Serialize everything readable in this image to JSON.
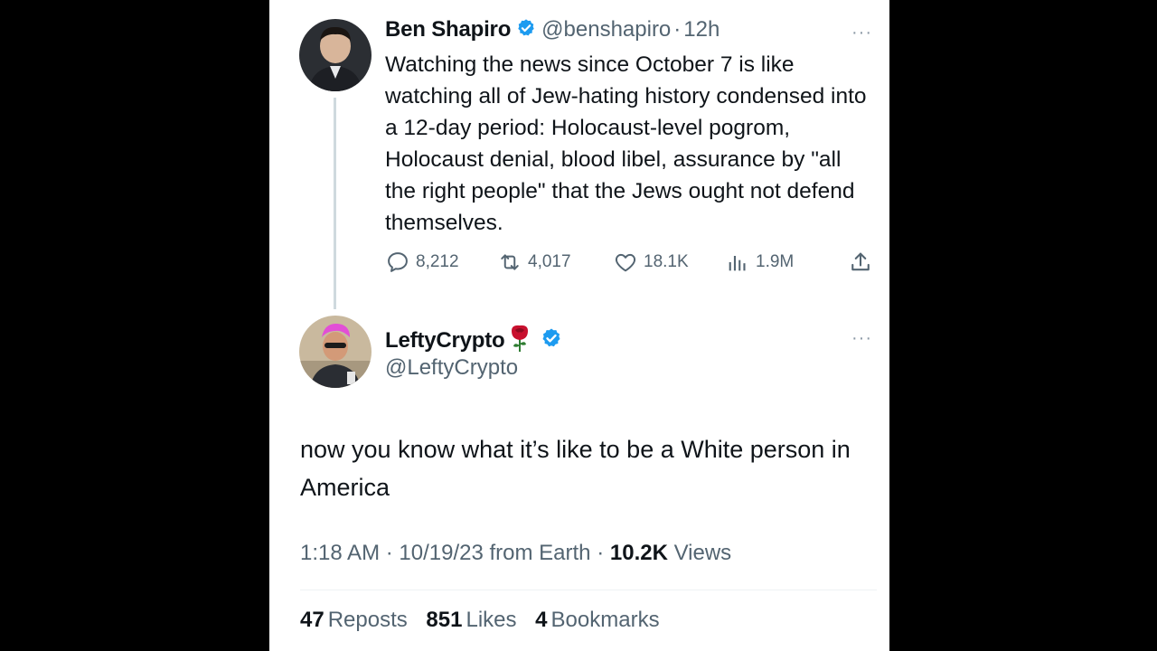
{
  "parent_tweet": {
    "author_name": "Ben Shapiro",
    "handle": "@benshapiro",
    "separator": "·",
    "time_ago": "12h",
    "more_label": "···",
    "text": "Watching the news since October 7 is like watching all of Jew-hating history condensed into a 12-day period: Holocaust-level pogrom, Holocaust denial, blood libel, assurance by \"all the right people\" that the Jews ought not defend themselves.",
    "actions": {
      "replies": "8,212",
      "reposts": "4,017",
      "likes": "18.1K",
      "views": "1.9M"
    },
    "icons": [
      "reply-icon",
      "repost-icon",
      "like-icon",
      "views-icon",
      "share-icon"
    ]
  },
  "reply_tweet": {
    "author_name": "LeftyCrypto",
    "name_emoji": "rose-icon",
    "handle": "@LeftyCrypto",
    "more_label": "···",
    "text": "now you know what it’s like to be a White person in America",
    "meta": {
      "time": "1:18 AM",
      "dot1": "·",
      "date": "10/19/23",
      "source": "from Earth",
      "dot2": "·",
      "views_count": "10.2K",
      "views_label": "Views"
    },
    "stats": {
      "reposts_count": "47",
      "reposts_label": "Reposts",
      "likes_count": "851",
      "likes_label": "Likes",
      "bookmarks_count": "4",
      "bookmarks_label": "Bookmarks"
    }
  },
  "colors": {
    "verified_blue": "#1d9bf0",
    "text_primary": "#0f1419",
    "text_secondary": "#536471",
    "thread_line": "#cfd9de",
    "rose_red": "#c8102e"
  }
}
